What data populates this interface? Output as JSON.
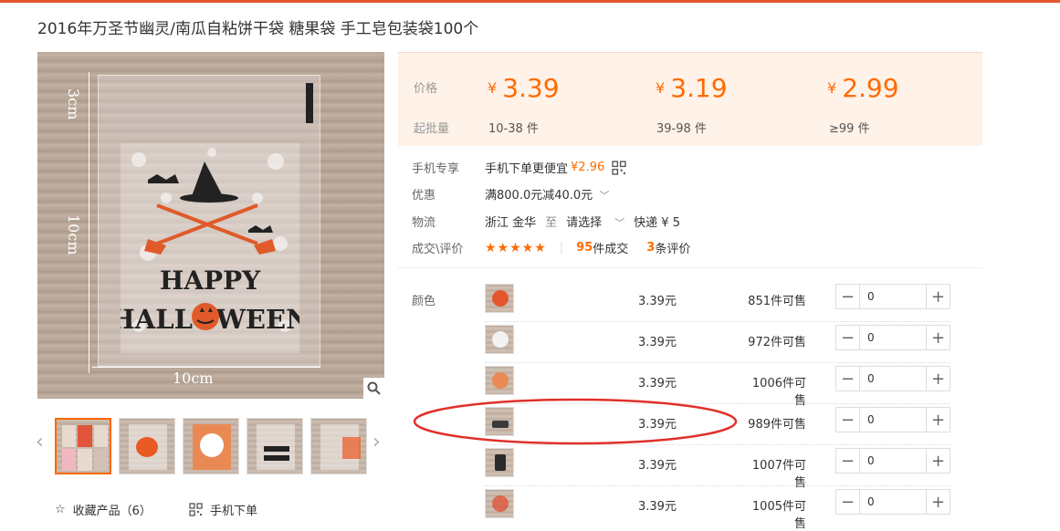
{
  "title": "2016年万圣节幽灵/南瓜自粘饼干袋 糖果袋 手工皂包装袋100个",
  "main_image": {
    "measure_top": "3cm",
    "measure_side": "10cm",
    "measure_bottom": "10cm",
    "print_line1": "HAPPY",
    "print_line2": "HALLOWEEN",
    "zoom_icon": "magnifier-icon"
  },
  "thumbs": {
    "prev": "‹",
    "next": "›",
    "count": 5
  },
  "bottom_links": {
    "favorite_label": "收藏产品（6）",
    "mobile_label": "手机下单"
  },
  "price_box": {
    "price_label": "价格",
    "moq_label": "起批量",
    "currency": "¥",
    "tiers": [
      {
        "price": "3.39",
        "range": "10-38 件"
      },
      {
        "price": "3.19",
        "range": "39-98 件"
      },
      {
        "price": "2.99",
        "range": "≥99 件"
      }
    ],
    "accent": "#ff6a00",
    "background": "#fff2e8"
  },
  "info": {
    "mobile_label": "手机专享",
    "mobile_text": "手机下单更便宜",
    "mobile_price": "¥2.96",
    "discount_label": "优惠",
    "discount_text": "满800.0元减40.0元",
    "logistics_label": "物流",
    "origin": "浙江 金华",
    "to": "至",
    "select": "请选择",
    "express": "快递 ¥ 5",
    "deal_label": "成交\\评价",
    "stars": "★★★★★",
    "deals_count": "95",
    "deals_text": "件成交",
    "reviews_count": "3",
    "reviews_text": "条评价"
  },
  "variants": {
    "color_label": "颜色",
    "rows": [
      {
        "price": "3.39元",
        "stock": "851件可售",
        "qty": "0"
      },
      {
        "price": "3.39元",
        "stock": "972件可售",
        "qty": "0"
      },
      {
        "price": "3.39元",
        "stock": "1006件可售",
        "qty": "0"
      },
      {
        "price": "3.39元",
        "stock": "989件可售",
        "qty": "0"
      },
      {
        "price": "3.39元",
        "stock": "1007件可售",
        "qty": "0"
      },
      {
        "price": "3.39元",
        "stock": "1005件可售",
        "qty": "0"
      }
    ],
    "minus": "−",
    "plus": "+"
  },
  "annotation_color": "#e0302a"
}
